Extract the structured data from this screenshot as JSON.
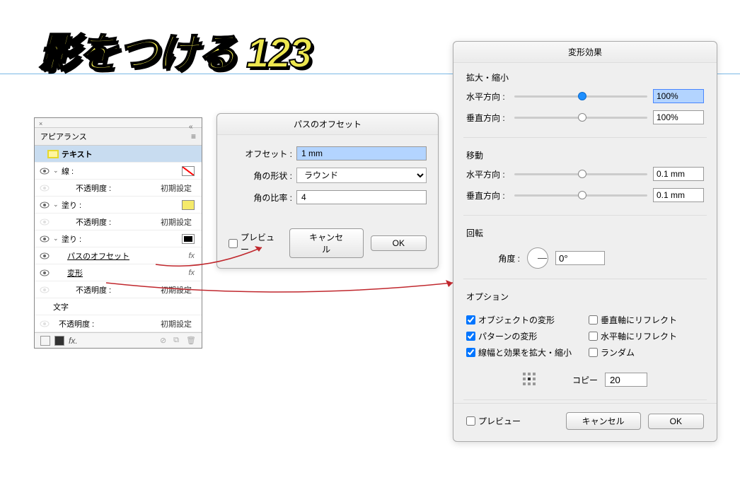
{
  "main_title": "影をつける 123",
  "appearance": {
    "title": "アピアランス",
    "text_row": "テキスト",
    "stroke_label": "線 :",
    "opacity_label": "不透明度 :",
    "opacity_value": "初期設定",
    "fill_label": "塗り :",
    "offset_effect": "パスのオフセット",
    "transform_effect": "変形",
    "characters": "文字",
    "fx": "fx"
  },
  "offset_dialog": {
    "title": "パスのオフセット",
    "offset_label": "オフセット :",
    "offset_value": "1 mm",
    "corner_label": "角の形状 :",
    "corner_value": "ラウンド",
    "ratio_label": "角の比率 :",
    "ratio_value": "4",
    "preview": "プレビュー",
    "cancel": "キャンセル",
    "ok": "OK"
  },
  "transform_dialog": {
    "title": "変形効果",
    "scale_section": "拡大・縮小",
    "horizontal": "水平方向 :",
    "vertical": "垂直方向 :",
    "scale_h": "100%",
    "scale_v": "100%",
    "move_section": "移動",
    "move_h": "0.1 mm",
    "move_v": "0.1 mm",
    "rotate_section": "回転",
    "angle_label": "角度 :",
    "angle_value": "0°",
    "options_section": "オプション",
    "opt_object": "オブジェクトの変形",
    "opt_reflect_v": "垂直軸にリフレクト",
    "opt_pattern": "パターンの変形",
    "opt_reflect_h": "水平軸にリフレクト",
    "opt_stroke": "線幅と効果を拡大・縮小",
    "opt_random": "ランダム",
    "copy_label": "コピー",
    "copy_value": "20",
    "preview": "プレビュー",
    "cancel": "キャンセル",
    "ok": "OK"
  }
}
